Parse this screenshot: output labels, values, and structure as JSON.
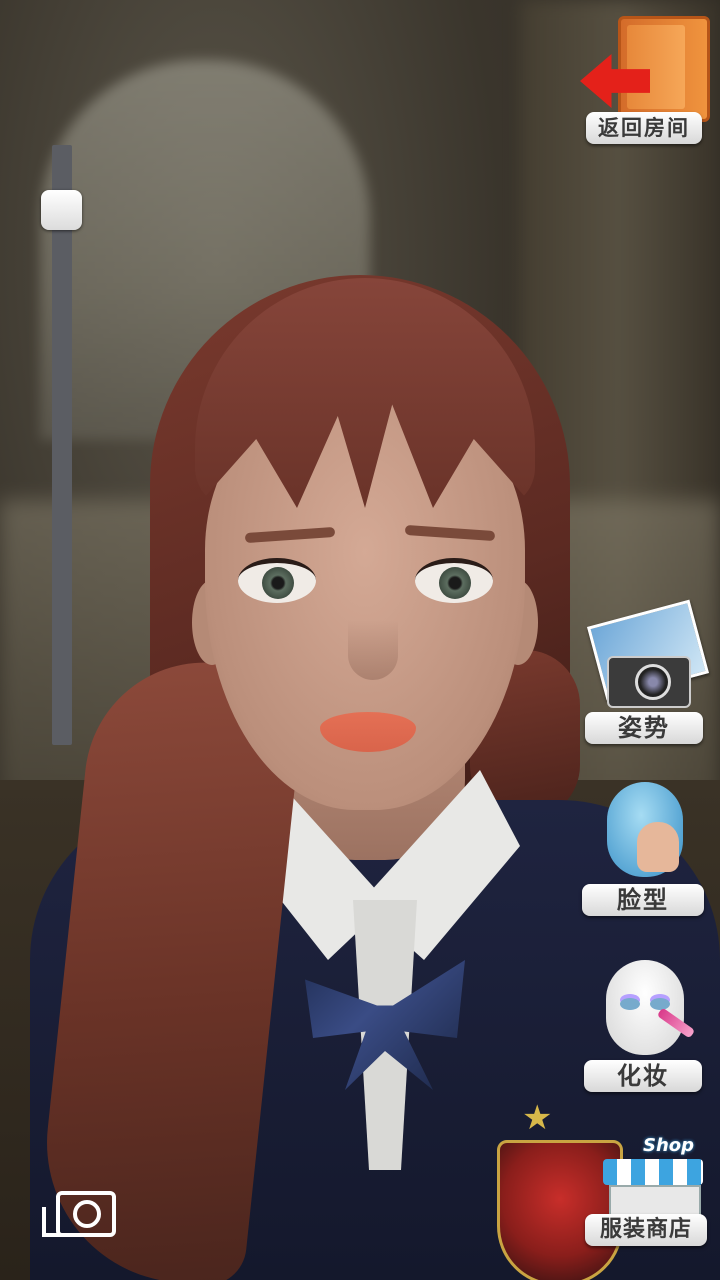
{
  "header": {
    "back_label": "返回房间"
  },
  "right_menu": {
    "pose_label": "姿势",
    "face_label": "脸型",
    "makeup_label": "化妆",
    "shop_label": "服装商店",
    "shop_sign": "Shop"
  },
  "zoom_slider": {
    "level": 0.92
  },
  "colors": {
    "back_arrow": "#e4211a",
    "door": "#f0943e",
    "button_bg": "#ffffff",
    "slider_track": "#5b5d63"
  },
  "icons": [
    "door-icon",
    "back-arrow-icon",
    "camera-icon",
    "face-shape-icon",
    "makeup-icon",
    "shop-icon",
    "screenshot-icon"
  ]
}
